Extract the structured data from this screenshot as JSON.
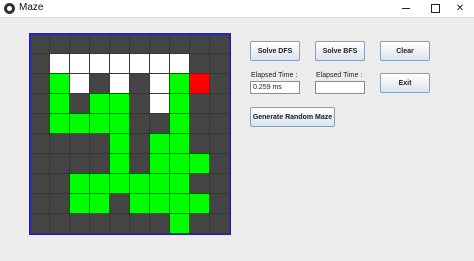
{
  "window": {
    "title": "Maze",
    "minimize_glyph": "",
    "maximize_glyph": "",
    "close_glyph": "✕"
  },
  "colors": {
    "wall": "#444444",
    "open": "#ffffff",
    "path": "#00ff00",
    "goal": "#ff0000",
    "grid_line": "#2626b8"
  },
  "maze": {
    "rows": [
      "##########",
      "#OOOOOOO##",
      "#PO#O#OPG#",
      "#P#PP#OP##",
      "#PPPP##P##",
      "####P#PP##",
      "####P#PPP#",
      "##PPPPPP##",
      "##PP#PPPP#",
      "#######P##"
    ]
  },
  "controls": {
    "solve_dfs": "Solve DFS",
    "solve_bfs": "Solve BFS",
    "clear": "Clear",
    "exit": "Exit",
    "generate": "Generate Random Maze",
    "elapsed_label_1": "Elapsed Time :",
    "elapsed_label_2": "Elapsed Time :",
    "elapsed_value_1": "0.259 ms",
    "elapsed_value_2": ""
  }
}
